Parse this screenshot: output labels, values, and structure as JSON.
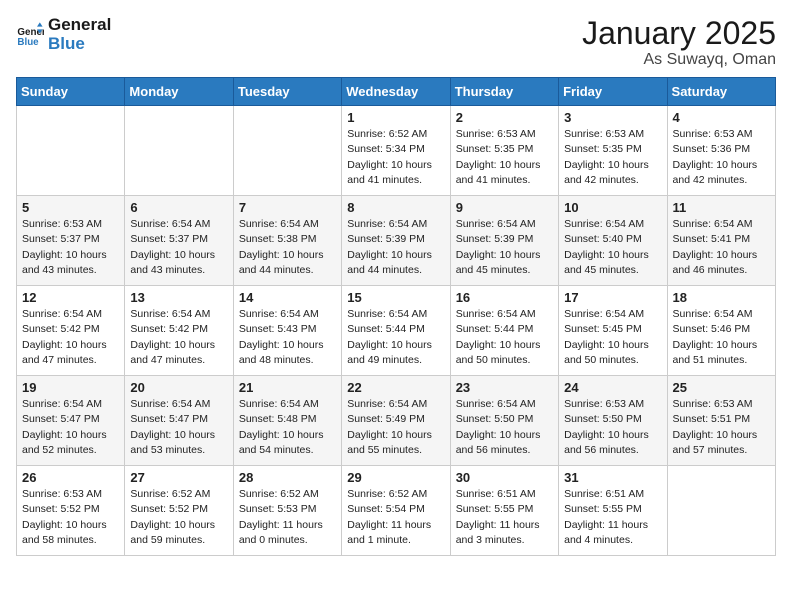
{
  "header": {
    "logo_line1": "General",
    "logo_line2": "Blue",
    "title": "January 2025",
    "subtitle": "As Suwayq, Oman"
  },
  "days_of_week": [
    "Sunday",
    "Monday",
    "Tuesday",
    "Wednesday",
    "Thursday",
    "Friday",
    "Saturday"
  ],
  "weeks": [
    [
      {
        "num": "",
        "sunrise": "",
        "sunset": "",
        "daylight": ""
      },
      {
        "num": "",
        "sunrise": "",
        "sunset": "",
        "daylight": ""
      },
      {
        "num": "",
        "sunrise": "",
        "sunset": "",
        "daylight": ""
      },
      {
        "num": "1",
        "sunrise": "Sunrise: 6:52 AM",
        "sunset": "Sunset: 5:34 PM",
        "daylight": "Daylight: 10 hours and 41 minutes."
      },
      {
        "num": "2",
        "sunrise": "Sunrise: 6:53 AM",
        "sunset": "Sunset: 5:35 PM",
        "daylight": "Daylight: 10 hours and 41 minutes."
      },
      {
        "num": "3",
        "sunrise": "Sunrise: 6:53 AM",
        "sunset": "Sunset: 5:35 PM",
        "daylight": "Daylight: 10 hours and 42 minutes."
      },
      {
        "num": "4",
        "sunrise": "Sunrise: 6:53 AM",
        "sunset": "Sunset: 5:36 PM",
        "daylight": "Daylight: 10 hours and 42 minutes."
      }
    ],
    [
      {
        "num": "5",
        "sunrise": "Sunrise: 6:53 AM",
        "sunset": "Sunset: 5:37 PM",
        "daylight": "Daylight: 10 hours and 43 minutes."
      },
      {
        "num": "6",
        "sunrise": "Sunrise: 6:54 AM",
        "sunset": "Sunset: 5:37 PM",
        "daylight": "Daylight: 10 hours and 43 minutes."
      },
      {
        "num": "7",
        "sunrise": "Sunrise: 6:54 AM",
        "sunset": "Sunset: 5:38 PM",
        "daylight": "Daylight: 10 hours and 44 minutes."
      },
      {
        "num": "8",
        "sunrise": "Sunrise: 6:54 AM",
        "sunset": "Sunset: 5:39 PM",
        "daylight": "Daylight: 10 hours and 44 minutes."
      },
      {
        "num": "9",
        "sunrise": "Sunrise: 6:54 AM",
        "sunset": "Sunset: 5:39 PM",
        "daylight": "Daylight: 10 hours and 45 minutes."
      },
      {
        "num": "10",
        "sunrise": "Sunrise: 6:54 AM",
        "sunset": "Sunset: 5:40 PM",
        "daylight": "Daylight: 10 hours and 45 minutes."
      },
      {
        "num": "11",
        "sunrise": "Sunrise: 6:54 AM",
        "sunset": "Sunset: 5:41 PM",
        "daylight": "Daylight: 10 hours and 46 minutes."
      }
    ],
    [
      {
        "num": "12",
        "sunrise": "Sunrise: 6:54 AM",
        "sunset": "Sunset: 5:42 PM",
        "daylight": "Daylight: 10 hours and 47 minutes."
      },
      {
        "num": "13",
        "sunrise": "Sunrise: 6:54 AM",
        "sunset": "Sunset: 5:42 PM",
        "daylight": "Daylight: 10 hours and 47 minutes."
      },
      {
        "num": "14",
        "sunrise": "Sunrise: 6:54 AM",
        "sunset": "Sunset: 5:43 PM",
        "daylight": "Daylight: 10 hours and 48 minutes."
      },
      {
        "num": "15",
        "sunrise": "Sunrise: 6:54 AM",
        "sunset": "Sunset: 5:44 PM",
        "daylight": "Daylight: 10 hours and 49 minutes."
      },
      {
        "num": "16",
        "sunrise": "Sunrise: 6:54 AM",
        "sunset": "Sunset: 5:44 PM",
        "daylight": "Daylight: 10 hours and 50 minutes."
      },
      {
        "num": "17",
        "sunrise": "Sunrise: 6:54 AM",
        "sunset": "Sunset: 5:45 PM",
        "daylight": "Daylight: 10 hours and 50 minutes."
      },
      {
        "num": "18",
        "sunrise": "Sunrise: 6:54 AM",
        "sunset": "Sunset: 5:46 PM",
        "daylight": "Daylight: 10 hours and 51 minutes."
      }
    ],
    [
      {
        "num": "19",
        "sunrise": "Sunrise: 6:54 AM",
        "sunset": "Sunset: 5:47 PM",
        "daylight": "Daylight: 10 hours and 52 minutes."
      },
      {
        "num": "20",
        "sunrise": "Sunrise: 6:54 AM",
        "sunset": "Sunset: 5:47 PM",
        "daylight": "Daylight: 10 hours and 53 minutes."
      },
      {
        "num": "21",
        "sunrise": "Sunrise: 6:54 AM",
        "sunset": "Sunset: 5:48 PM",
        "daylight": "Daylight: 10 hours and 54 minutes."
      },
      {
        "num": "22",
        "sunrise": "Sunrise: 6:54 AM",
        "sunset": "Sunset: 5:49 PM",
        "daylight": "Daylight: 10 hours and 55 minutes."
      },
      {
        "num": "23",
        "sunrise": "Sunrise: 6:54 AM",
        "sunset": "Sunset: 5:50 PM",
        "daylight": "Daylight: 10 hours and 56 minutes."
      },
      {
        "num": "24",
        "sunrise": "Sunrise: 6:53 AM",
        "sunset": "Sunset: 5:50 PM",
        "daylight": "Daylight: 10 hours and 56 minutes."
      },
      {
        "num": "25",
        "sunrise": "Sunrise: 6:53 AM",
        "sunset": "Sunset: 5:51 PM",
        "daylight": "Daylight: 10 hours and 57 minutes."
      }
    ],
    [
      {
        "num": "26",
        "sunrise": "Sunrise: 6:53 AM",
        "sunset": "Sunset: 5:52 PM",
        "daylight": "Daylight: 10 hours and 58 minutes."
      },
      {
        "num": "27",
        "sunrise": "Sunrise: 6:52 AM",
        "sunset": "Sunset: 5:52 PM",
        "daylight": "Daylight: 10 hours and 59 minutes."
      },
      {
        "num": "28",
        "sunrise": "Sunrise: 6:52 AM",
        "sunset": "Sunset: 5:53 PM",
        "daylight": "Daylight: 11 hours and 0 minutes."
      },
      {
        "num": "29",
        "sunrise": "Sunrise: 6:52 AM",
        "sunset": "Sunset: 5:54 PM",
        "daylight": "Daylight: 11 hours and 1 minute."
      },
      {
        "num": "30",
        "sunrise": "Sunrise: 6:51 AM",
        "sunset": "Sunset: 5:55 PM",
        "daylight": "Daylight: 11 hours and 3 minutes."
      },
      {
        "num": "31",
        "sunrise": "Sunrise: 6:51 AM",
        "sunset": "Sunset: 5:55 PM",
        "daylight": "Daylight: 11 hours and 4 minutes."
      },
      {
        "num": "",
        "sunrise": "",
        "sunset": "",
        "daylight": ""
      }
    ]
  ]
}
